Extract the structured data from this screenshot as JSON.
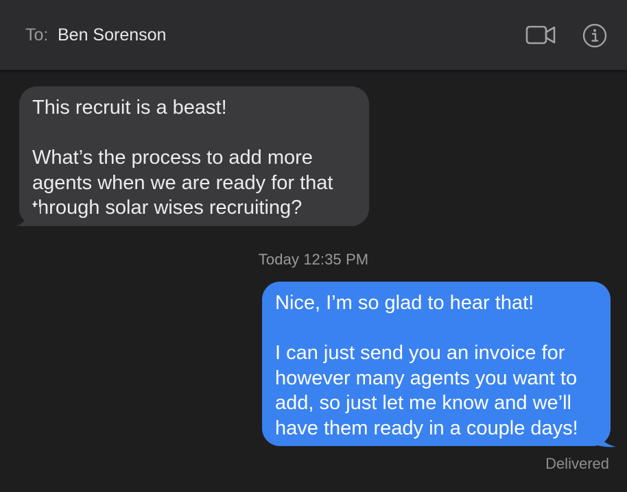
{
  "header": {
    "to_label": "To:",
    "recipient": "Ben Sorenson",
    "video_icon": "video-camera-icon",
    "info_icon": "info-icon"
  },
  "messages": [
    {
      "direction": "incoming",
      "text": "This recruit is a beast!\n\nWhat’s the process to add more agents when we are ready for that through solar wises recruiting?"
    },
    {
      "direction": "outgoing",
      "text": "Nice, I’m so glad to hear that!\n\nI can just send you an invoice for however many agents you want to add, so just let me know and we’ll have them ready in a couple days!"
    }
  ],
  "timestamp": "Today 12:35 PM",
  "delivery_status": "Delivered",
  "colors": {
    "background": "#1e1e1e",
    "header": "#2c2c2e",
    "incoming_bubble": "#3a3a3c",
    "outgoing_bubble": "#3a82f0",
    "secondary_text": "#9a9a9e"
  }
}
